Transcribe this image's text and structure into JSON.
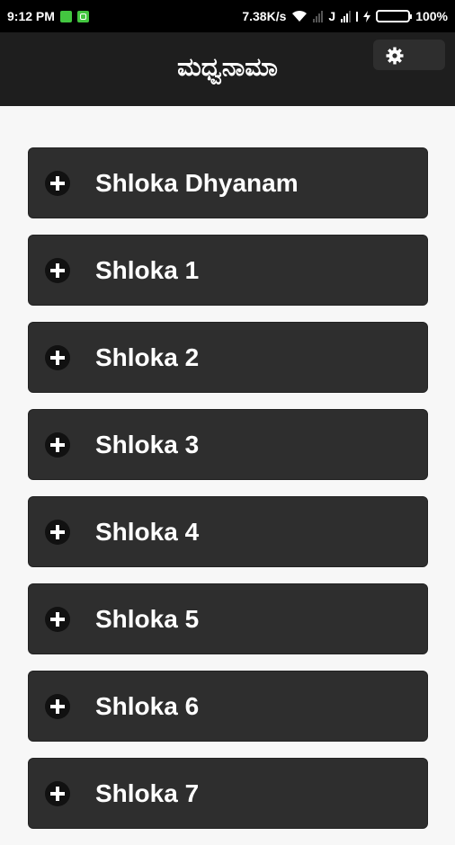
{
  "status_bar": {
    "time": "9:12 PM",
    "speed": "7.38K/s",
    "carrier_letter": "J",
    "battery_percent": "100%",
    "icons": [
      "notification-icon",
      "wifi-icon",
      "signal-icon",
      "charging-icon",
      "battery-icon"
    ],
    "battery_level": 1.0
  },
  "header": {
    "title": "ಮಧ್ವನಾಮಾ",
    "settings_icon": "gear-icon",
    "background": "#1e1e1e"
  },
  "list": {
    "items": [
      {
        "label": "Shloka Dhyanam"
      },
      {
        "label": "Shloka 1"
      },
      {
        "label": "Shloka 2"
      },
      {
        "label": "Shloka 3"
      },
      {
        "label": "Shloka 4"
      },
      {
        "label": "Shloka 5"
      },
      {
        "label": "Shloka 6"
      },
      {
        "label": "Shloka 7"
      }
    ],
    "expand_icon": "plus-icon"
  },
  "colors": {
    "item_bg": "#2e2e2e",
    "accent_green": "#43c640",
    "page_bg": "#f7f7f7"
  }
}
